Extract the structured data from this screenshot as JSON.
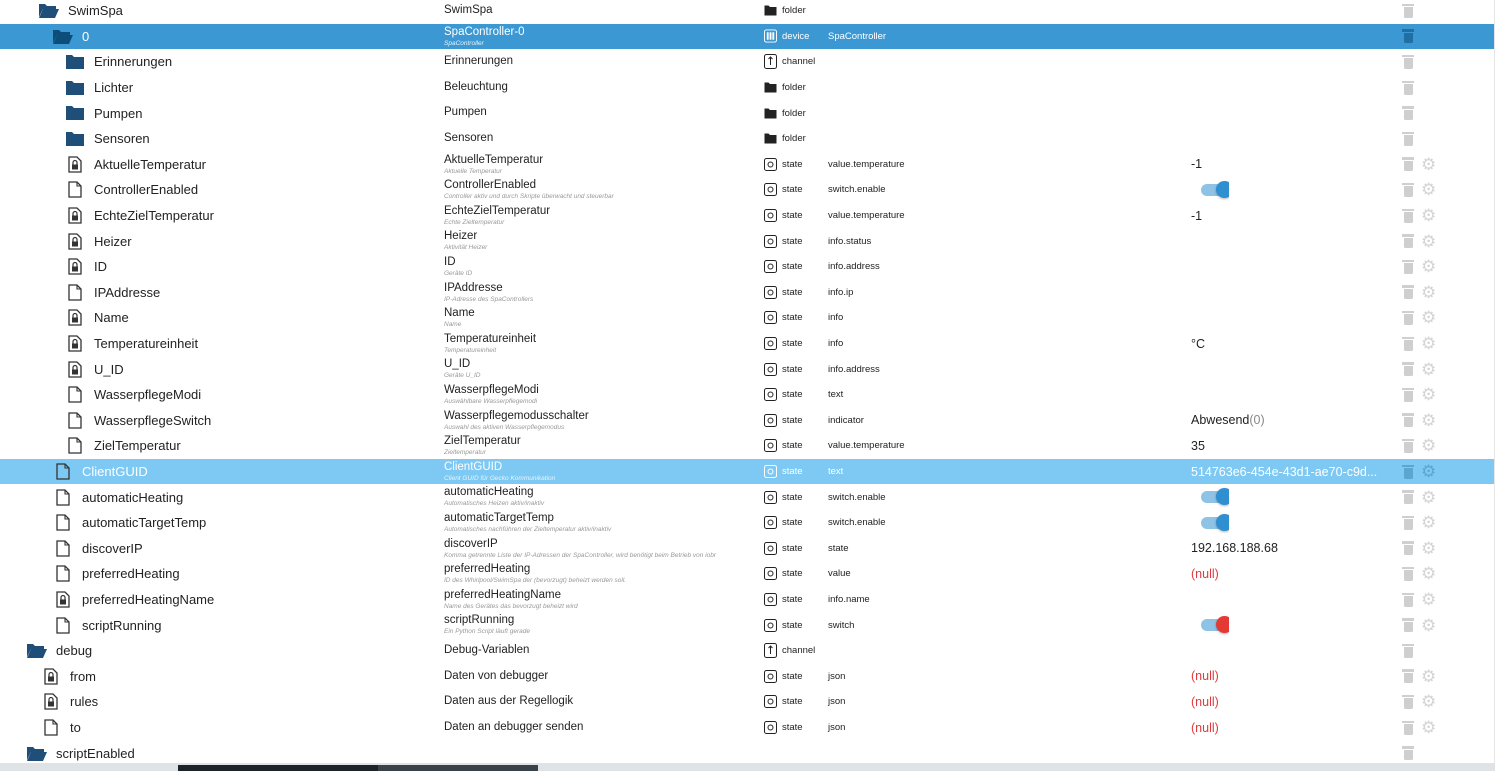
{
  "rows": [
    {
      "indent": 38,
      "icon": "folder-open-icon",
      "name": "SwimSpa",
      "desc": "SwimSpa",
      "sub": "",
      "type": "folder",
      "type_icon": "folder-small-icon",
      "role": "",
      "value": "",
      "value_kind": "",
      "gear": false,
      "sel": ""
    },
    {
      "indent": 52,
      "icon": "folder-open-icon",
      "name": "0",
      "desc": "SpaController-0",
      "sub": "SpaController",
      "type": "device",
      "type_icon": "device-icon",
      "role": "SpaController",
      "value": "",
      "value_kind": "",
      "gear": false,
      "sel": "dark"
    },
    {
      "indent": 64,
      "icon": "folder-closed-icon",
      "name": "Erinnerungen",
      "desc": "Erinnerungen",
      "sub": "",
      "type": "channel",
      "type_icon": "channel-icon",
      "role": "",
      "value": "",
      "value_kind": "",
      "gear": false,
      "sel": ""
    },
    {
      "indent": 64,
      "icon": "folder-closed-icon",
      "name": "Lichter",
      "desc": "Beleuchtung",
      "sub": "",
      "type": "folder",
      "type_icon": "folder-small-icon",
      "role": "",
      "value": "",
      "value_kind": "",
      "gear": false,
      "sel": ""
    },
    {
      "indent": 64,
      "icon": "folder-closed-icon",
      "name": "Pumpen",
      "desc": "Pumpen",
      "sub": "",
      "type": "folder",
      "type_icon": "folder-small-icon",
      "role": "",
      "value": "",
      "value_kind": "",
      "gear": false,
      "sel": ""
    },
    {
      "indent": 64,
      "icon": "folder-closed-icon",
      "name": "Sensoren",
      "desc": "Sensoren",
      "sub": "",
      "type": "folder",
      "type_icon": "folder-small-icon",
      "role": "",
      "value": "",
      "value_kind": "",
      "gear": false,
      "sel": ""
    },
    {
      "indent": 64,
      "icon": "file-lock-icon",
      "name": "AktuelleTemperatur",
      "desc": "AktuelleTemperatur",
      "sub": "Aktuelle Temperatur",
      "type": "state",
      "type_icon": "state-icon",
      "role": "value.temperature",
      "value": "-1",
      "value_kind": "text",
      "gear": true,
      "sel": ""
    },
    {
      "indent": 64,
      "icon": "file-icon",
      "name": "ControllerEnabled",
      "desc": "ControllerEnabled",
      "sub": "Controller aktiv und durch Skripte überwacht und steuerbar",
      "type": "state",
      "type_icon": "state-icon",
      "role": "switch.enable",
      "value": "",
      "value_kind": "toggle",
      "gear": true,
      "sel": ""
    },
    {
      "indent": 64,
      "icon": "file-lock-icon",
      "name": "EchteZielTemperatur",
      "desc": "EchteZielTemperatur",
      "sub": "Echte Zieltemperatur",
      "type": "state",
      "type_icon": "state-icon",
      "role": "value.temperature",
      "value": "-1",
      "value_kind": "text",
      "gear": true,
      "sel": ""
    },
    {
      "indent": 64,
      "icon": "file-lock-icon",
      "name": "Heizer",
      "desc": "Heizer",
      "sub": "Aktivität Heizer",
      "type": "state",
      "type_icon": "state-icon",
      "role": "info.status",
      "value": "",
      "value_kind": "",
      "gear": true,
      "sel": ""
    },
    {
      "indent": 64,
      "icon": "file-lock-icon",
      "name": "ID",
      "desc": "ID",
      "sub": "Geräte ID",
      "type": "state",
      "type_icon": "state-icon",
      "role": "info.address",
      "value": "",
      "value_kind": "",
      "gear": true,
      "sel": ""
    },
    {
      "indent": 64,
      "icon": "file-icon",
      "name": "IPAddresse",
      "desc": "IPAddresse",
      "sub": "IP-Adresse des SpaControllers",
      "type": "state",
      "type_icon": "state-icon",
      "role": "info.ip",
      "value": "",
      "value_kind": "",
      "gear": true,
      "sel": ""
    },
    {
      "indent": 64,
      "icon": "file-lock-icon",
      "name": "Name",
      "desc": "Name",
      "sub": "Name",
      "type": "state",
      "type_icon": "state-icon",
      "role": "info",
      "value": "",
      "value_kind": "",
      "gear": true,
      "sel": ""
    },
    {
      "indent": 64,
      "icon": "file-lock-icon",
      "name": "Temperatureinheit",
      "desc": "Temperatureinheit",
      "sub": "Temperatureinheit",
      "type": "state",
      "type_icon": "state-icon",
      "role": "info",
      "value": "°C",
      "value_kind": "text",
      "gear": true,
      "sel": ""
    },
    {
      "indent": 64,
      "icon": "file-lock-icon",
      "name": "U_ID",
      "desc": "U_ID",
      "sub": "Geräte U_ID",
      "type": "state",
      "type_icon": "state-icon",
      "role": "info.address",
      "value": "",
      "value_kind": "",
      "gear": true,
      "sel": ""
    },
    {
      "indent": 64,
      "icon": "file-icon",
      "name": "WasserpflegeModi",
      "desc": "WasserpflegeModi",
      "sub": "Auswählbare Wasserpflegemodi",
      "type": "state",
      "type_icon": "state-icon",
      "role": "text",
      "value": "",
      "value_kind": "",
      "gear": true,
      "sel": ""
    },
    {
      "indent": 64,
      "icon": "file-icon",
      "name": "WasserpflegeSwitch",
      "desc": "Wasserpflegemodusschalter",
      "sub": "Auswahl des aktiven Wasserpflegemodus",
      "type": "state",
      "type_icon": "state-icon",
      "role": "indicator",
      "value": "Abwesend",
      "value_extra": "(0)",
      "value_kind": "text",
      "gear": true,
      "sel": ""
    },
    {
      "indent": 64,
      "icon": "file-icon",
      "name": "ZielTemperatur",
      "desc": "ZielTemperatur",
      "sub": "Zieltemperatur",
      "type": "state",
      "type_icon": "state-icon",
      "role": "value.temperature",
      "value": "35",
      "value_kind": "text",
      "gear": true,
      "sel": ""
    },
    {
      "indent": 52,
      "icon": "file-icon",
      "name": "ClientGUID",
      "desc": "ClientGUID",
      "sub": "Client GUID für Gecko Kommunikation",
      "type": "state",
      "type_icon": "state-icon",
      "role": "text",
      "value": "514763e6-454e-43d1-ae70-c9d...",
      "value_kind": "text",
      "gear": true,
      "sel": "light"
    },
    {
      "indent": 52,
      "icon": "file-icon",
      "name": "automaticHeating",
      "desc": "automaticHeating",
      "sub": "Automatisches Heizen aktiv/inaktiv",
      "type": "state",
      "type_icon": "state-icon",
      "role": "switch.enable",
      "value": "",
      "value_kind": "toggle",
      "gear": true,
      "sel": ""
    },
    {
      "indent": 52,
      "icon": "file-icon",
      "name": "automaticTargetTemp",
      "desc": "automaticTargetTemp",
      "sub": "Automatisches nachführen der Zieltemperatur aktiv/inaktiv",
      "type": "state",
      "type_icon": "state-icon",
      "role": "switch.enable",
      "value": "",
      "value_kind": "toggle",
      "gear": true,
      "sel": ""
    },
    {
      "indent": 52,
      "icon": "file-icon",
      "name": "discoverIP",
      "desc": "discoverIP",
      "sub": "Komma getrennte Liste der IP-Adressen der SpaController, wird benötigt beim Betrieb von iobr",
      "type": "state",
      "type_icon": "state-icon",
      "role": "state",
      "value": "192.168.188.68",
      "value_kind": "text",
      "gear": true,
      "sel": ""
    },
    {
      "indent": 52,
      "icon": "file-icon",
      "name": "preferredHeating",
      "desc": "preferredHeating",
      "sub": "ID des Whirlpool/SwimSpa der (bevorzugt) beheizt werden soll.",
      "type": "state",
      "type_icon": "state-icon",
      "role": "value",
      "value": "(null)",
      "value_kind": "null",
      "gear": true,
      "sel": ""
    },
    {
      "indent": 52,
      "icon": "file-lock-icon",
      "name": "preferredHeatingName",
      "desc": "preferredHeatingName",
      "sub": "Name des Gerätes das bevorzugt beheizt wird",
      "type": "state",
      "type_icon": "state-icon",
      "role": "info.name",
      "value": "",
      "value_kind": "",
      "gear": true,
      "sel": ""
    },
    {
      "indent": 52,
      "icon": "file-icon",
      "name": "scriptRunning",
      "desc": "scriptRunning",
      "sub": "Ein Python Script läuft gerade",
      "type": "state",
      "type_icon": "state-icon",
      "role": "switch",
      "value": "",
      "value_kind": "toggle-red",
      "gear": true,
      "sel": ""
    },
    {
      "indent": 26,
      "icon": "folder-open-icon",
      "name": "debug",
      "desc": "Debug-Variablen",
      "sub": "",
      "type": "channel",
      "type_icon": "channel-icon",
      "role": "",
      "value": "",
      "value_kind": "",
      "gear": false,
      "sel": ""
    },
    {
      "indent": 40,
      "icon": "file-lock-icon",
      "name": "from",
      "desc": "Daten von debugger",
      "sub": "",
      "type": "state",
      "type_icon": "state-icon",
      "role": "json",
      "value": "(null)",
      "value_kind": "null",
      "gear": true,
      "sel": ""
    },
    {
      "indent": 40,
      "icon": "file-lock-icon",
      "name": "rules",
      "desc": "Daten aus der Regellogik",
      "sub": "",
      "type": "state",
      "type_icon": "state-icon",
      "role": "json",
      "value": "(null)",
      "value_kind": "null",
      "gear": true,
      "sel": ""
    },
    {
      "indent": 40,
      "icon": "file-icon",
      "name": "to",
      "desc": "Daten an debugger senden",
      "sub": "",
      "type": "state",
      "type_icon": "state-icon",
      "role": "json",
      "value": "(null)",
      "value_kind": "null",
      "gear": true,
      "sel": ""
    },
    {
      "indent": 26,
      "icon": "folder-open-icon",
      "name": "scriptEnabled",
      "desc": "",
      "sub": "",
      "type": "",
      "type_icon": "",
      "role": "",
      "value": "",
      "value_kind": "",
      "gear": false,
      "sel": ""
    }
  ],
  "colors": {
    "selected_dark": "#3b98d3",
    "selected_light": "#7dc9f4",
    "folder": "#1f4e79",
    "toggle_on": "#2e8fd1",
    "toggle_red": "#e53935",
    "null_text": "#e03b3b"
  }
}
